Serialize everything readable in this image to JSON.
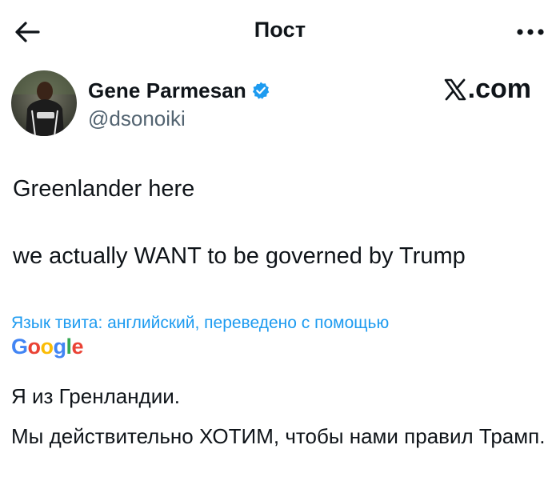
{
  "header": {
    "title": "Пост"
  },
  "author": {
    "name": "Gene Parmesan",
    "handle": "@dsonoiki",
    "verified": true
  },
  "watermark": {
    "text": ".com"
  },
  "tweet": {
    "lines": [
      "Greenlander here",
      "we actually WANT to be governed by Trump"
    ]
  },
  "translation": {
    "note": "Язык твита: английский, переведено с помощью",
    "provider_letters": [
      "G",
      "o",
      "o",
      "g",
      "l",
      "e"
    ],
    "provider_colors": [
      "#4285f4",
      "#ea4335",
      "#fbbc05",
      "#4285f4",
      "#34a853",
      "#ea4335"
    ],
    "lines": [
      "Я из Гренландии.",
      "Мы действительно ХОТИМ, чтобы нами правил Трамп."
    ]
  },
  "colors": {
    "link": "#1d9bf0",
    "verified_badge": "#1d9bf0",
    "secondary_text": "#536471"
  },
  "icons": {
    "back": "arrow-left-icon",
    "more": "more-horizontal-icon",
    "verified": "verified-badge-icon",
    "logo": "x-logo-icon"
  }
}
